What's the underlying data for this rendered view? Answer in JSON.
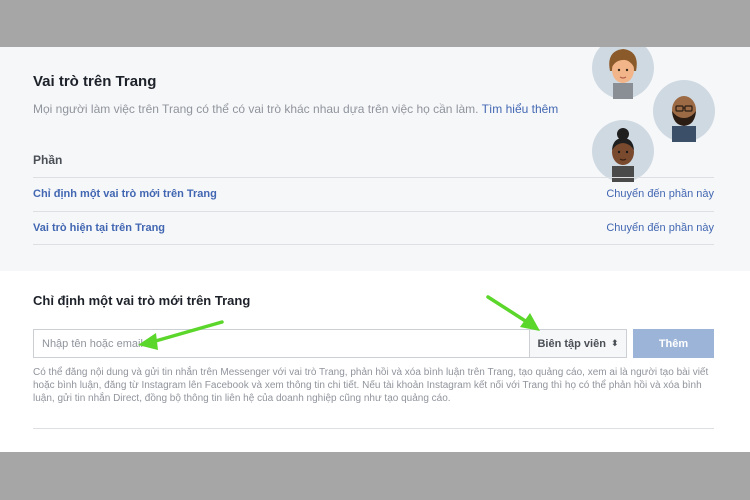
{
  "roles_section": {
    "title": "Vai trò trên Trang",
    "description": "Mọi người làm việc trên Trang có thể có vai trò khác nhau dựa trên việc họ cần làm.",
    "learn_more": "Tìm hiểu thêm",
    "heading": "Phần",
    "rows": [
      {
        "label": "Chỉ định một vai trò mới trên Trang",
        "action": "Chuyển đến phần này"
      },
      {
        "label": "Vai trò hiện tại trên Trang",
        "action": "Chuyển đến phần này"
      }
    ]
  },
  "assign_section": {
    "title": "Chỉ định một vai trò mới trên Trang",
    "input_placeholder": "Nhập tên hoặc email",
    "input_value": "",
    "role_selected": "Biên tập viên",
    "add_button": "Thêm",
    "help_lines": [
      "Có thể đăng nội dung và gửi tin nhắn trên Messenger với vai trò Trang, phản hồi và xóa bình luận trên Trang, tạo quảng cáo, xem ai là người tạo bài viết",
      "hoặc bình luận, đăng từ Instagram lên Facebook và xem thông tin chi tiết. Nếu tài khoản Instagram kết nối với Trang thì họ có thể phản hồi và xóa bình",
      "luận, gửi tin nhắn Direct, đồng bộ thông tin liên hệ của doanh nghiệp cũng như tạo quảng cáo."
    ]
  },
  "colors": {
    "link": "#4267b2",
    "button_disabled": "#9cb4d8",
    "arrow": "#5bd62a",
    "outer_background": "#a6a6a6"
  },
  "icons": [
    "person-avatar-icon",
    "chevron-updown-icon",
    "green-arrow-annotation"
  ]
}
